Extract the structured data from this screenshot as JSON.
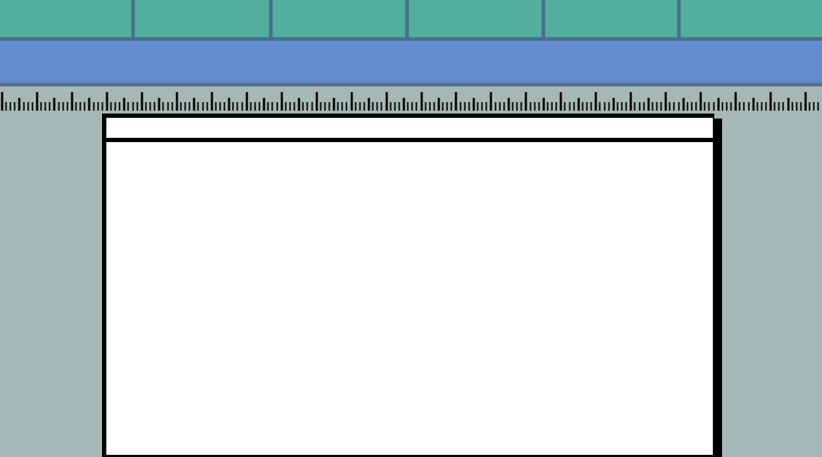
{
  "tabs": [
    {
      "label": ""
    },
    {
      "label": ""
    },
    {
      "label": ""
    },
    {
      "label": ""
    },
    {
      "label": ""
    },
    {
      "label": ""
    }
  ],
  "toolbar": {
    "label": ""
  },
  "document": {
    "header_text": "",
    "body_text": ""
  },
  "colors": {
    "tab_bg": "#52ae9d",
    "tab_separator": "#4a6f8d",
    "toolbar_bg": "#628bcf",
    "workspace_bg": "#a5b8b5",
    "page_bg": "#ffffff",
    "page_border": "#000000"
  }
}
